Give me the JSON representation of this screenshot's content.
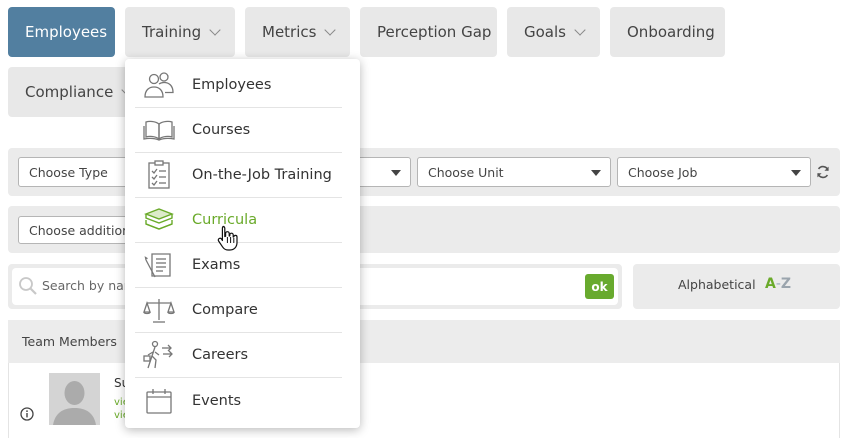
{
  "tabs": [
    {
      "label": "Employees",
      "active": true
    },
    {
      "label": "Training",
      "has_menu": true
    },
    {
      "label": "Metrics",
      "has_menu": true
    },
    {
      "label": "Perception Gap"
    },
    {
      "label": "Goals",
      "has_menu": true
    },
    {
      "label": "Onboarding"
    },
    {
      "label": "Compliance",
      "has_menu": true
    }
  ],
  "filters": {
    "type_placeholder": "Choose Type",
    "unit_placeholder": "Choose Unit",
    "job_placeholder": "Choose Job",
    "additional_placeholder": "Choose additional"
  },
  "search": {
    "placeholder": "Search by name",
    "ok_label": "ok"
  },
  "sort": {
    "label": "Alphabetical",
    "az_a": "A",
    "az_dash": "-",
    "az_z": "Z"
  },
  "team": {
    "header": "Team Members",
    "member_name_fragment": "Su",
    "link_fragment_1": "vie",
    "link_fragment_2": "vie"
  },
  "training_menu": {
    "items": [
      {
        "label": "Employees",
        "icon": "people-icon"
      },
      {
        "label": "Courses",
        "icon": "open-book-icon"
      },
      {
        "label": "On-the-Job Training",
        "icon": "checklist-icon"
      },
      {
        "label": "Curricula",
        "icon": "stacked-books-icon",
        "hovered": true
      },
      {
        "label": "Exams",
        "icon": "exam-icon"
      },
      {
        "label": "Compare",
        "icon": "scales-icon"
      },
      {
        "label": "Careers",
        "icon": "career-icon"
      },
      {
        "label": "Events",
        "icon": "calendar-icon"
      }
    ]
  },
  "colors": {
    "active_tab": "#527fa0",
    "accent_green": "#6aaa2a",
    "ok_button": "#68aa2e"
  }
}
